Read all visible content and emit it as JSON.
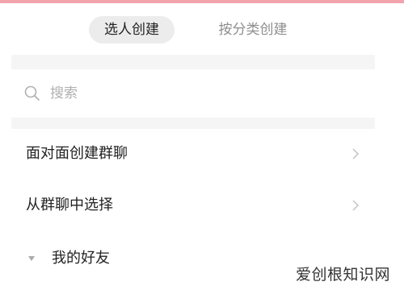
{
  "colors": {
    "accent_strip": "#f3a3ad",
    "tab_active_bg": "#ececec",
    "tab_active_text": "#222222",
    "tab_inactive_text": "#8e8e8e",
    "band_bg": "#f5f5f5",
    "placeholder": "#b0b0b0",
    "chevron": "#c4c4c4",
    "triangle": "#aaaaaa",
    "watermark": "#333333"
  },
  "tabs": [
    {
      "label": "选人创建",
      "active": true
    },
    {
      "label": "按分类创建",
      "active": false
    }
  ],
  "search": {
    "placeholder": "搜索",
    "value": "",
    "icon": "search-icon"
  },
  "menu": [
    {
      "label": "面对面创建群聊",
      "icon": "chevron-right-icon"
    },
    {
      "label": "从群聊中选择",
      "icon": "chevron-right-icon"
    }
  ],
  "friends_group": {
    "label": "我的好友",
    "icon": "triangle-down-icon"
  },
  "watermark": {
    "text": "爱创根知识网"
  }
}
